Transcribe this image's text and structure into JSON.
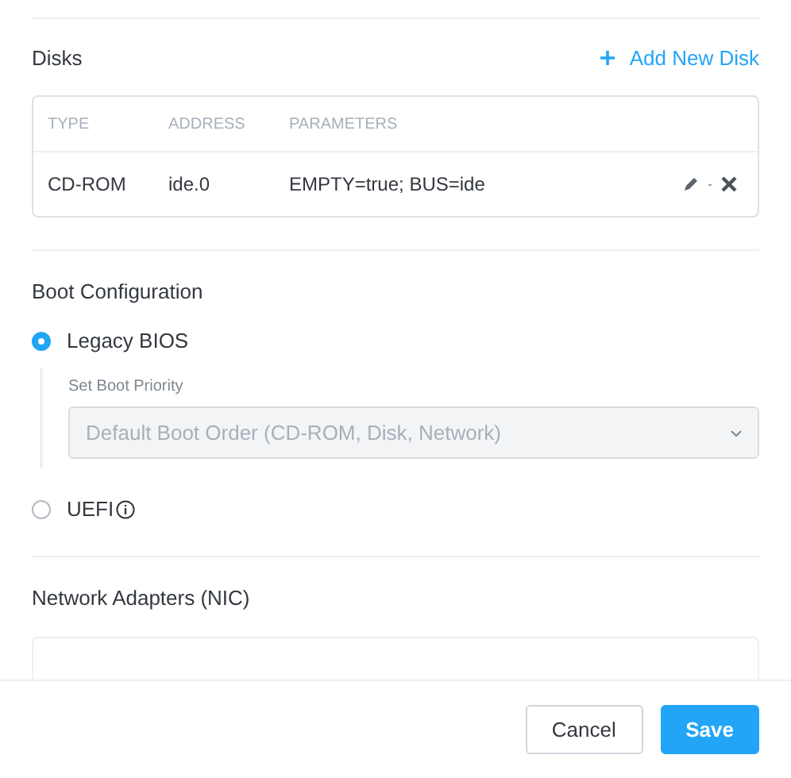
{
  "disks": {
    "title": "Disks",
    "add_button": "Add New Disk",
    "columns": [
      "TYPE",
      "ADDRESS",
      "PARAMETERS"
    ],
    "rows": [
      {
        "type": "CD-ROM",
        "address": "ide.0",
        "parameters": "EMPTY=true; BUS=ide"
      }
    ]
  },
  "boot": {
    "title": "Boot Configuration",
    "options": [
      {
        "label": "Legacy BIOS",
        "selected": true,
        "info": false
      },
      {
        "label": "UEFI",
        "selected": false,
        "info": true
      }
    ],
    "priority_label": "Set Boot Priority",
    "priority_value": "Default Boot Order (CD-ROM, Disk, Network)",
    "priority_disabled": true
  },
  "nics": {
    "title": "Network Adapters (NIC)"
  },
  "footer": {
    "buttons": [
      {
        "label": "Cancel",
        "kind": "secondary"
      },
      {
        "label": "Save",
        "kind": "primary"
      }
    ]
  }
}
